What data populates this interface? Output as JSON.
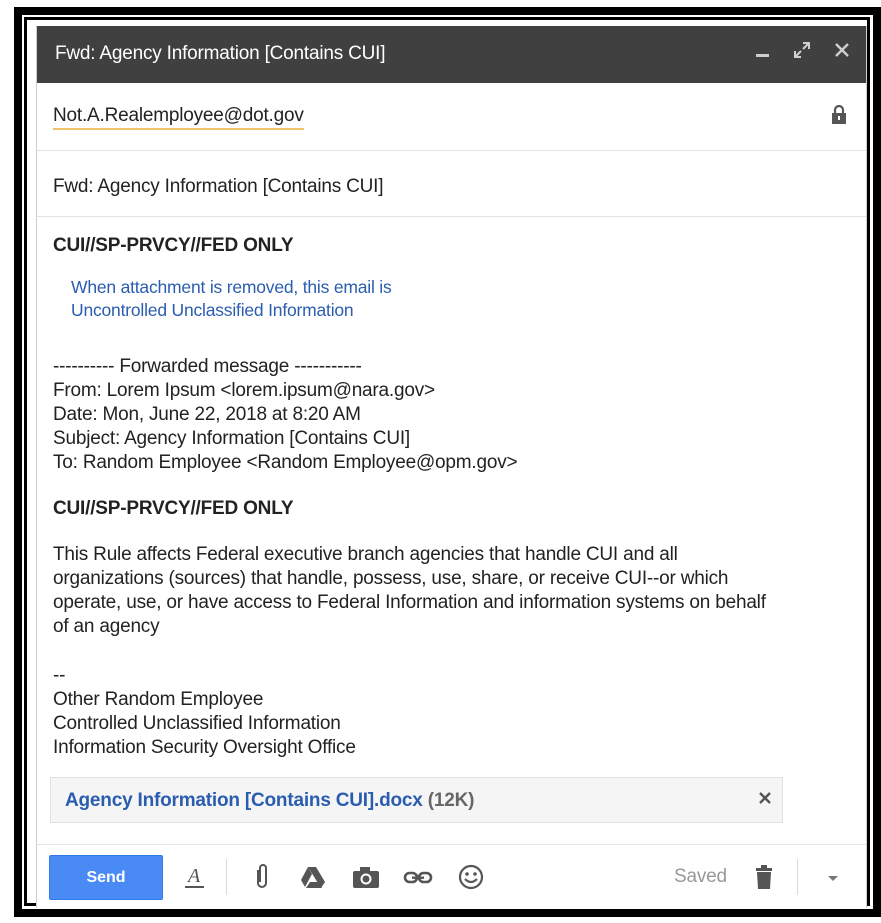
{
  "window": {
    "title": "Fwd: Agency Information [Contains CUI]",
    "minimize_icon": "minimize-icon",
    "expand_icon": "expand-icon",
    "close_icon": "close-icon"
  },
  "recipient": {
    "to": "Not.A.Realemployee@dot.gov",
    "lock_icon": "lock-icon"
  },
  "subject": "Fwd: Agency Information [Contains CUI]",
  "body": {
    "banner_top": "CUI//SP-PRVCY//FED ONLY",
    "note_line1": "When attachment is removed, this email is",
    "note_line2": "Uncontrolled Unclassified Information",
    "forward_header": "---------- Forwarded message -----------",
    "from": "From: Lorem Ipsum <lorem.ipsum@nara.gov>",
    "date": "Date: Mon, June 22, 2018 at 8:20 AM",
    "subject_line": "Subject: Agency Information [Contains CUI]",
    "to_line": "To: Random Employee <Random Employee@opm.gov>",
    "banner_middle": "CUI//SP-PRVCY//FED ONLY",
    "paragraph_line1": "This Rule affects Federal executive branch agencies that handle CUI and all",
    "paragraph_line2": "organizations (sources) that handle, possess, use, share, or receive CUI--or which",
    "paragraph_line3": "operate, use, or have access to Federal Information and information systems on behalf",
    "paragraph_line4": "of an agency",
    "sig_dashes": "--",
    "sig_name": "Other Random Employee",
    "sig_line2": "Controlled Unclassified Information",
    "sig_line3": "Information Security Oversight Office"
  },
  "attachment": {
    "filename": "Agency Information [Contains CUI].docx",
    "size": "(12K)",
    "remove_icon": "close-icon"
  },
  "toolbar": {
    "send_label": "Send",
    "saved_label": "Saved",
    "icons": [
      "format-text-icon",
      "attach-file-icon",
      "google-drive-icon",
      "camera-icon",
      "link-icon",
      "emoji-icon",
      "trash-icon",
      "more-options-icon"
    ]
  }
}
